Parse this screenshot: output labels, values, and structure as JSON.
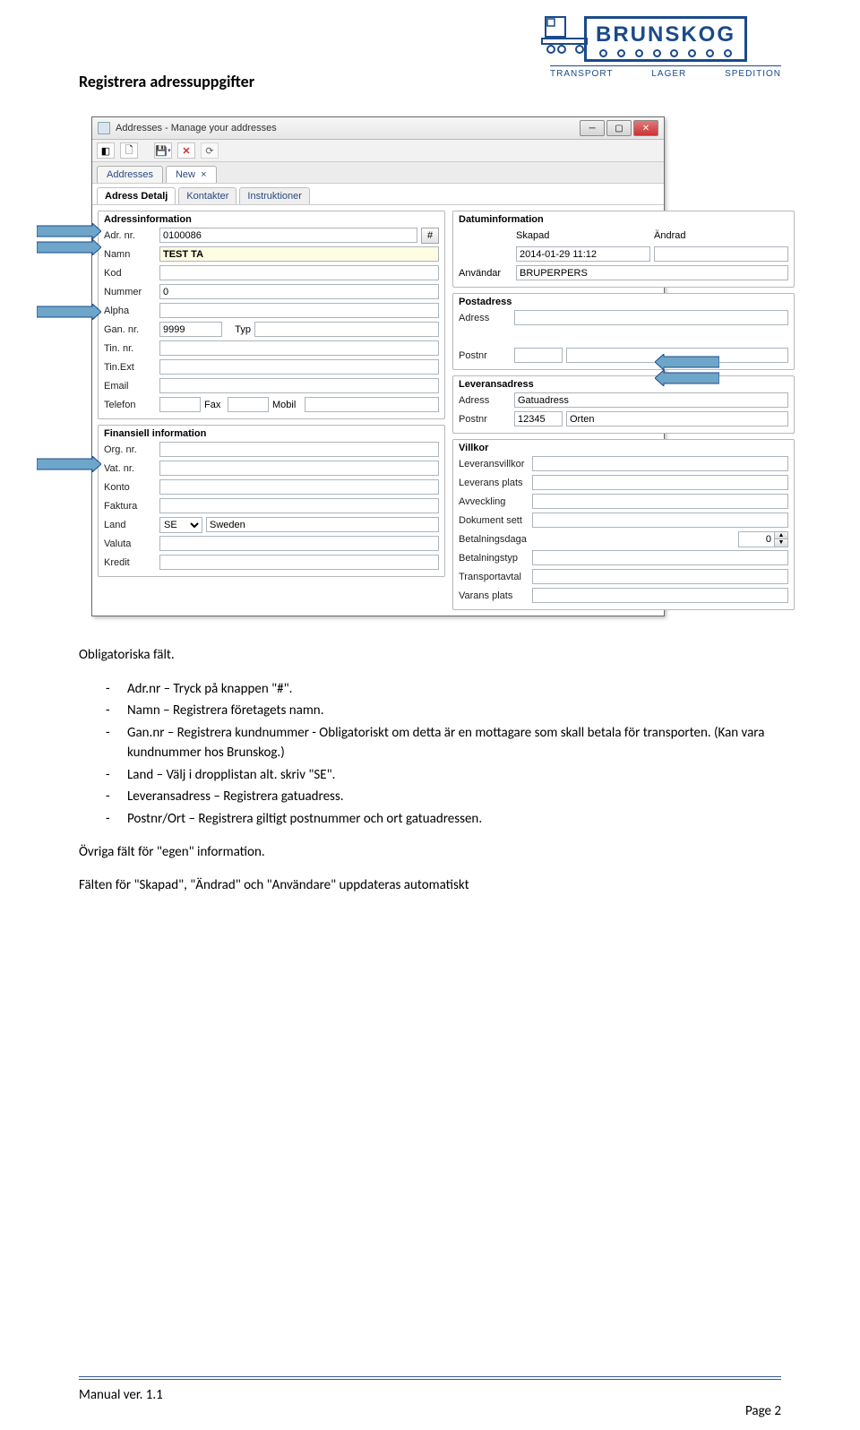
{
  "logo": {
    "name": "BRUNSKOG",
    "tag1": "TRANSPORT",
    "tag2": "LAGER",
    "tag3": "SPEDITION"
  },
  "section_heading": "Registrera adressuppgifter",
  "window": {
    "title": "Addresses - Manage your addresses",
    "tabs": {
      "addresses": "Addresses",
      "new": "New"
    },
    "subtabs": {
      "detail": "Adress Detalj",
      "contacts": "Kontakter",
      "instructions": "Instruktioner"
    },
    "adressinfo": {
      "title": "Adressinformation",
      "adr_nr_label": "Adr. nr.",
      "adr_nr": "0100086",
      "hash": "#",
      "namn_label": "Namn",
      "namn": "TEST TA",
      "kod_label": "Kod",
      "nummer_label": "Nummer",
      "nummer": "0",
      "alpha_label": "Alpha",
      "gan_nr_label": "Gan. nr.",
      "gan_nr": "9999",
      "typ_label": "Typ",
      "tin_nr_label": "Tin. nr.",
      "tin_ext_label": "Tin.Ext",
      "email_label": "Email",
      "telefon_label": "Telefon",
      "fax_label": "Fax",
      "mobil_label": "Mobil"
    },
    "finansiell": {
      "title": "Finansiell information",
      "org_nr_label": "Org. nr.",
      "vat_nr_label": "Vat. nr.",
      "konto_label": "Konto",
      "faktura_label": "Faktura",
      "land_label": "Land",
      "land_code": "SE",
      "land_name": "Sweden",
      "valuta_label": "Valuta",
      "kredit_label": "Kredit"
    },
    "datum": {
      "title": "Datuminformation",
      "skapad_label": "Skapad",
      "andrad_label": "Ändrad",
      "skapad_val": "2014-01-29 11:12",
      "anvandar_label": "Användar",
      "anvandar_val": "BRUPERPERS"
    },
    "post": {
      "title": "Postadress",
      "adress_label": "Adress",
      "postnr_label": "Postnr"
    },
    "leverans": {
      "title": "Leveransadress",
      "adress_label": "Adress",
      "adress_val": "Gatuadress",
      "postnr_label": "Postnr",
      "postnr_val": "12345",
      "ort_val": "Orten"
    },
    "villkor": {
      "title": "Villkor",
      "lev_villkor": "Leveransvillkor",
      "lev_plats": "Leverans plats",
      "avveckling": "Avveckling",
      "dok_sett": "Dokument sett",
      "betaldagar": "Betalningsdaga",
      "betaldagar_val": "0",
      "betaltyp": "Betalningstyp",
      "transportavtal": "Transportavtal",
      "varans_plats": "Varans plats"
    }
  },
  "text": {
    "oblig": "Obligatoriska fält.",
    "b1": "Adr.nr – Tryck på knappen \"#\".",
    "b2": "Namn – Registrera företagets namn.",
    "b3": "Gan.nr – Registrera kundnummer - Obligatoriskt om detta är en mottagare som skall betala för transporten. (Kan vara kundnummer hos Brunskog.)",
    "b4": "Land – Välj i dropplistan alt. skriv \"SE\".",
    "b5": "Leveransadress – Registrera gatuadress.",
    "b6": "Postnr/Ort – Registrera giltigt postnummer och ort gatuadressen.",
    "ovriga": "Övriga fält för \"egen\" information.",
    "falten": "Fälten för \"Skapad\", \"Ändrad\" och \"Användare\" uppdateras automatiskt"
  },
  "footer": {
    "manual": "Manual ver. 1.1",
    "page": "Page 2"
  }
}
